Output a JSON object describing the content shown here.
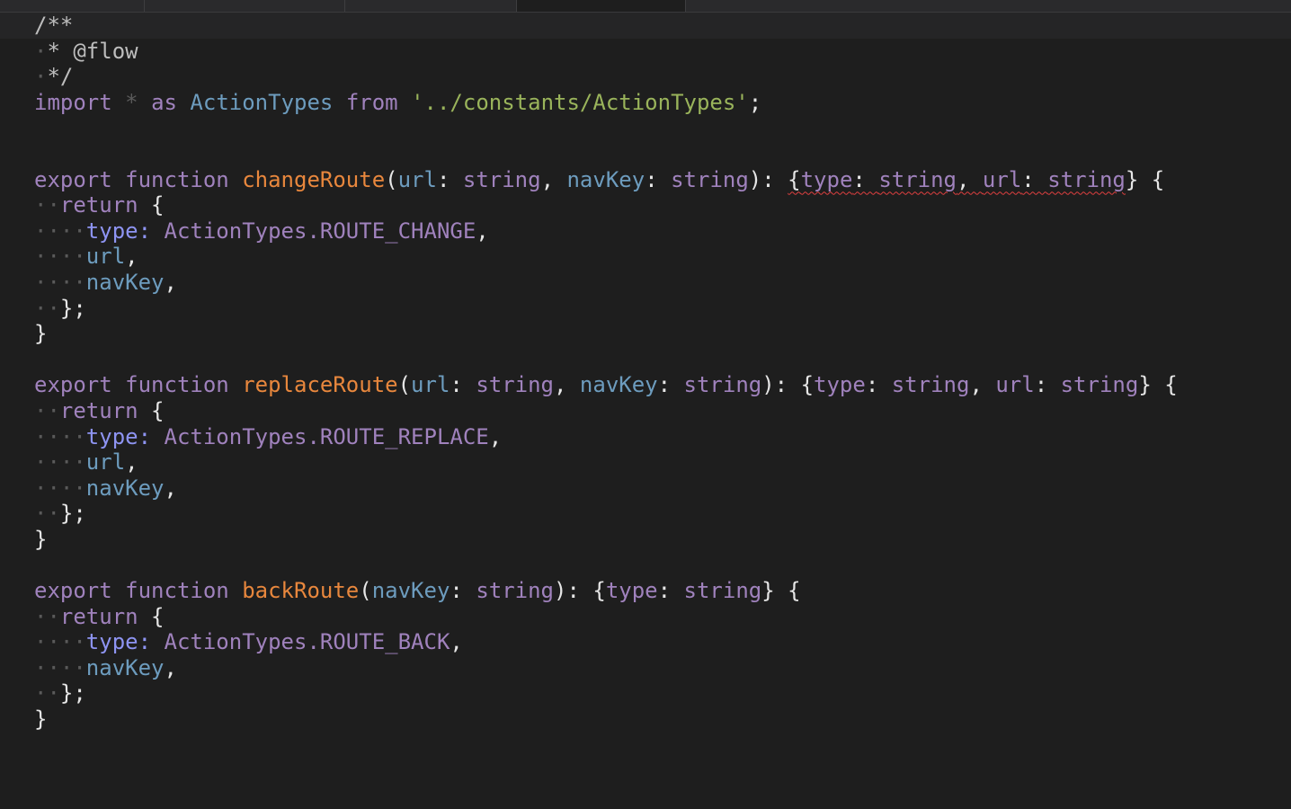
{
  "tabs": [
    {
      "label": "",
      "active": false
    },
    {
      "label": "",
      "active": false
    },
    {
      "label": "",
      "active": false
    },
    {
      "label": "",
      "active": true
    }
  ],
  "code": {
    "l1_comment_open": "/**",
    "l2_comment_flow": "* @flow",
    "l3_comment_close": "*/",
    "import": {
      "kw_import": "import",
      "star": "*",
      "kw_as": "as",
      "ns": "ActionTypes",
      "kw_from": "from",
      "path": "'../constants/ActionTypes'",
      "semi": ";"
    },
    "kw_export": "export",
    "kw_function": "function",
    "kw_return": "return",
    "kw_type_key": "type",
    "ty_string": "string",
    "p_url": "url",
    "p_navKey": "navKey",
    "ns_ActionTypes": "ActionTypes",
    "fn1_name": "changeRoute",
    "fn1_const": "ROUTE_CHANGE",
    "fn2_name": "replaceRoute",
    "fn2_const": "ROUTE_REPLACE",
    "fn3_name": "backRoute",
    "fn3_const": "ROUTE_BACK"
  },
  "colors": {
    "background": "#1e1e1e",
    "keyword": "#a082bd",
    "function_name": "#e8873d",
    "parameter": "#6d9cbe",
    "string": "#9ab45b",
    "object_key": "#8e94f2",
    "error_squiggle": "#e04040"
  }
}
